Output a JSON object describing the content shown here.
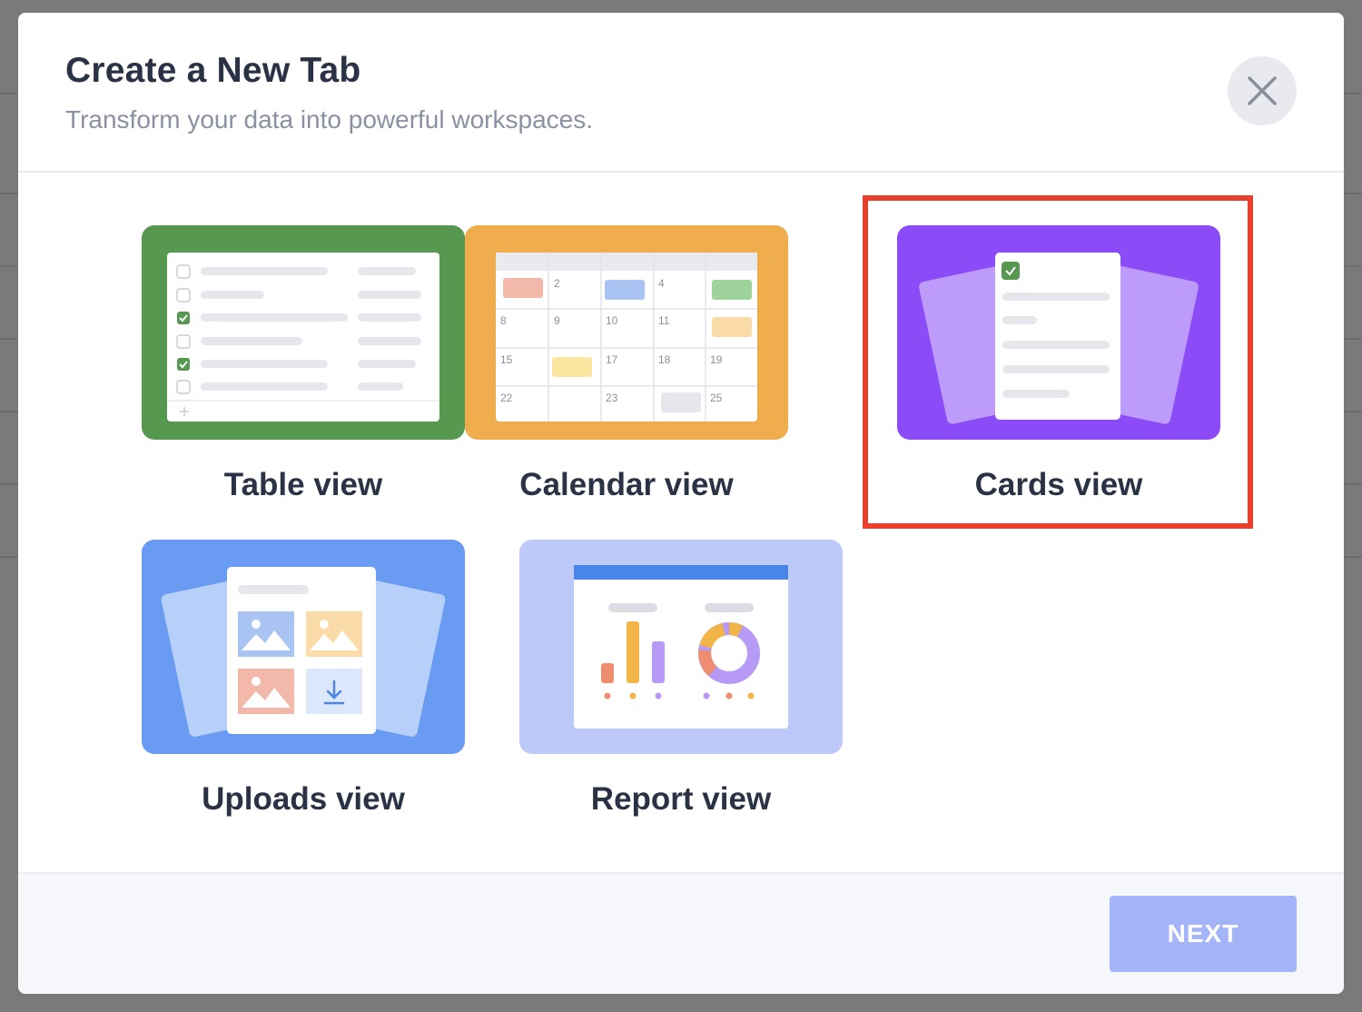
{
  "modal": {
    "title": "Create a New Tab",
    "subtitle": "Transform your data into powerful workspaces.",
    "close_icon": "close-icon"
  },
  "options": [
    {
      "label": "Table view",
      "icon": "table-view-illustration",
      "color": "#579851",
      "selected": false
    },
    {
      "label": "Calendar view",
      "icon": "calendar-view-illustration",
      "color": "#f0ad4e",
      "selected": false
    },
    {
      "label": "Cards view",
      "icon": "cards-view-illustration",
      "color": "#8b4cf7",
      "selected": true
    },
    {
      "label": "Uploads view",
      "icon": "uploads-view-illustration",
      "color": "#6a9bf2",
      "selected": false
    },
    {
      "label": "Report view",
      "icon": "report-view-illustration",
      "color": "#bdc9f9",
      "selected": false
    }
  ],
  "calendar_days": [
    "2",
    "4",
    "8",
    "9",
    "10",
    "11",
    "15",
    "17",
    "18",
    "19",
    "22",
    "23",
    "25"
  ],
  "footer": {
    "next_label": "NEXT"
  },
  "accent": {
    "selection_outline": "#e8402c",
    "next_button": "#a3b4f8"
  }
}
